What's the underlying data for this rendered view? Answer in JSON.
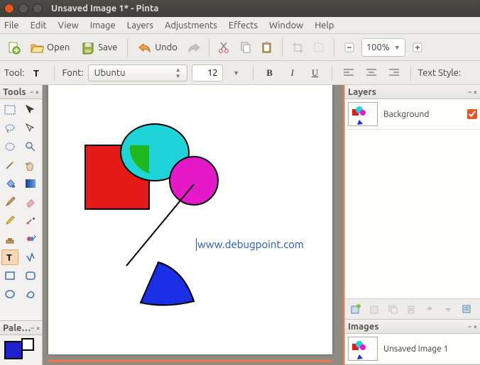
{
  "window": {
    "title": "Unsaved Image 1* - Pinta"
  },
  "menu": {
    "items": [
      "File",
      "Edit",
      "View",
      "Image",
      "Layers",
      "Adjustments",
      "Effects",
      "Window",
      "Help"
    ]
  },
  "toolbar": {
    "open": "Open",
    "save": "Save",
    "undo": "Undo",
    "zoom": "100%"
  },
  "options": {
    "tool_label": "Tool:",
    "font_label": "Font:",
    "font": "Ubuntu",
    "size": "12",
    "textstyle_label": "Text Style:"
  },
  "panels": {
    "tools": "Tools",
    "palette": "Pale…",
    "layers": "Layers",
    "images": "Images"
  },
  "layers": {
    "items": [
      {
        "name": "Background",
        "visible": true
      }
    ]
  },
  "images": {
    "items": [
      {
        "name": "Unsaved Image 1"
      }
    ]
  },
  "canvas": {
    "text": "www.debugpoint.com"
  },
  "colors": {
    "fg": "#2020d0",
    "bg": "#ffffff"
  }
}
